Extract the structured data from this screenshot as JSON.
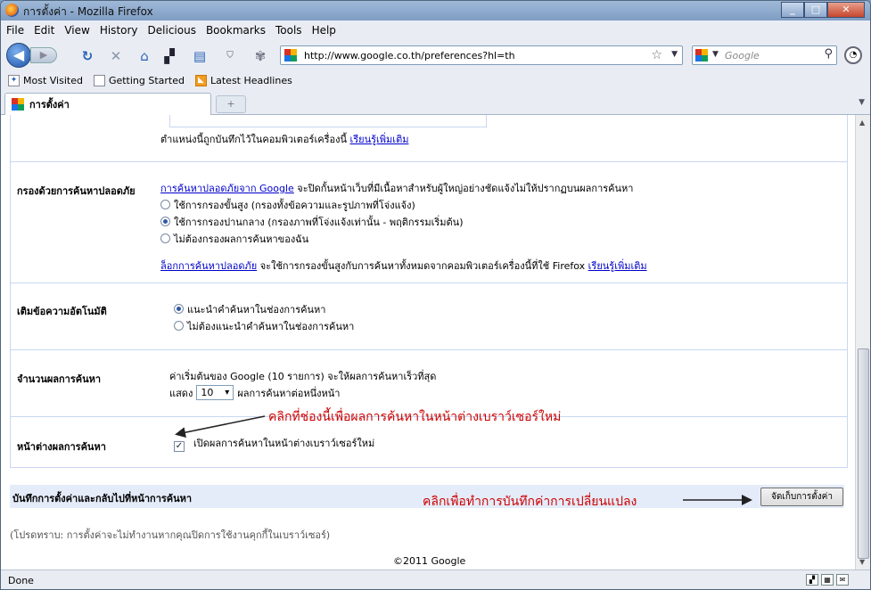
{
  "window": {
    "title": "การตั้งค่า - Mozilla Firefox",
    "min": "_",
    "max": "□",
    "close": "✕"
  },
  "menu": [
    "File",
    "Edit",
    "View",
    "History",
    "Delicious",
    "Bookmarks",
    "Tools",
    "Help"
  ],
  "nav": {
    "url": "http://www.google.co.th/preferences?hl=th",
    "search_placeholder": "Google"
  },
  "bookmarks": [
    "Most Visited",
    "Getting Started",
    "Latest Headlines"
  ],
  "tab": {
    "title": "การตั้งค่า",
    "new_tab": "+"
  },
  "prefs": {
    "location_note": "ตำแหน่งนี้ถูกบันทึกไว้ในคอมพิวเตอร์เครื่องนี้",
    "learn_more": "เรียนรู้เพิ่มเติม",
    "safesearch": {
      "label": "กรองด้วยการค้นหาปลอดภัย",
      "link": "การค้นหาปลอดภัยจาก Google",
      "desc": " จะปิดกั้นหน้าเว็บที่มีเนื้อหาสำหรับผู้ใหญ่อย่างชัดแจ้งไม่ให้ปรากฏบนผลการค้นหา",
      "options": [
        "ใช้การกรองขั้นสูง (กรองทั้งข้อความและรูปภาพที่โจ่งแจ้ง)",
        "ใช้การกรองปานกลาง (กรองภาพที่โจ่งแจ้งเท่านั้น - พฤติกรรมเริ่มต้น)",
        "ไม่ต้องกรองผลการค้นหาของฉัน"
      ],
      "selected": 1,
      "lock_link": "ล็อกการค้นหาปลอดภัย",
      "lock_desc": " จะใช้การกรองขั้นสูงกับการค้นหาทั้งหมดจากคอมพิวเตอร์เครื่องนี้ที่ใช้ Firefox ",
      "learn_more": "เรียนรู้เพิ่มเติม"
    },
    "autocomplete": {
      "label": "เติมข้อความอัตโนมัติ",
      "options": [
        "แนะนำคำค้นหาในช่องการค้นหา",
        "ไม่ต้องแนะนำคำค้นหาในช่องการค้นหา"
      ],
      "selected": 0
    },
    "results": {
      "label": "จำนวนผลการค้นหา",
      "desc": "ค่าเริ่มต้นของ Google (10 รายการ) จะให้ผลการค้นหาเร็วที่สุด",
      "show": "แสดง",
      "value": "10",
      "suffix": "ผลการค้นหาต่อหนึ่งหน้า"
    },
    "window": {
      "label": "หน้าต่างผลการค้นหา",
      "checkbox": "เปิดผลการค้นหาในหน้าต่างเบราว์เซอร์ใหม่",
      "checked": true
    },
    "save": {
      "label": "บันทึกการตั้งค่าและกลับไปที่หน้าการค้นหา",
      "button": "จัดเก็บการตั้งค่า"
    },
    "note": "(โปรดทราบ: การตั้งค่าจะไม่ทำงานหากคุณปิดการใช้งานคุกกี้ในเบราว์เซอร์)",
    "copyright": "©2011 Google"
  },
  "annotations": {
    "checkbox_hint": "คลิกที่ช่องนี้เพื่อผลการค้นหาในหน้าต่างเบราว์เซอร์ใหม่",
    "save_hint": "คลิกเพื่อทำการบันทึกค่าการเปลี่ยนแปลง"
  },
  "status": "Done",
  "colors": {
    "link": "#0000cc",
    "annotation": "#cc0000",
    "border": "#c9d7f1"
  }
}
